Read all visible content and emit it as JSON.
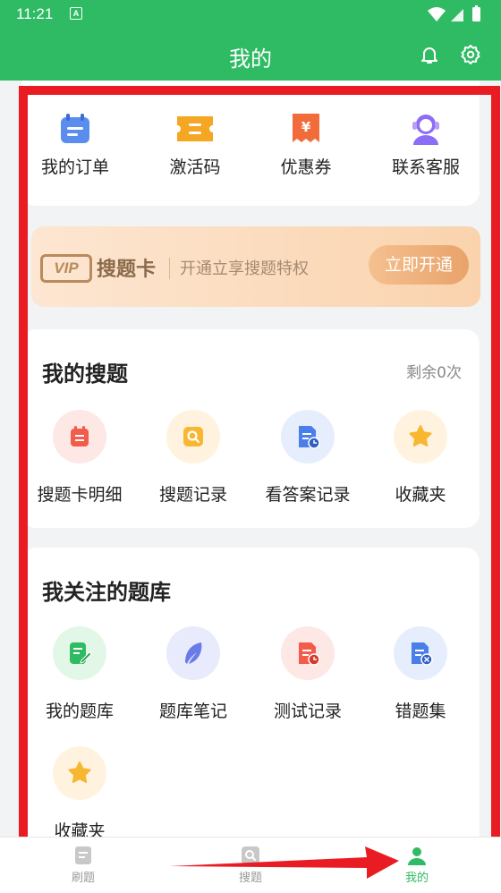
{
  "status_bar": {
    "time": "11:21",
    "notification_icon": "A"
  },
  "header": {
    "title": "我的"
  },
  "quick_actions": [
    {
      "label": "我的订单",
      "icon": "calendar-icon",
      "color": "#5b8def"
    },
    {
      "label": "激活码",
      "icon": "ticket-icon",
      "color": "#f5a623"
    },
    {
      "label": "优惠券",
      "icon": "coupon-icon",
      "color": "#f26b3a"
    },
    {
      "label": "联系客服",
      "icon": "headset-icon",
      "color": "#8d6df5"
    }
  ],
  "vip": {
    "badge": "VIP",
    "title": "搜题卡",
    "desc": "开通立享搜题特权",
    "button": "立即开通"
  },
  "my_search": {
    "title": "我的搜题",
    "remaining": "剩余0次",
    "items": [
      {
        "label": "搜题卡明细",
        "icon": "card-detail-icon"
      },
      {
        "label": "搜题记录",
        "icon": "search-record-icon"
      },
      {
        "label": "看答案记录",
        "icon": "answer-record-icon"
      },
      {
        "label": "收藏夹",
        "icon": "star-icon"
      }
    ]
  },
  "my_library": {
    "title": "我关注的题库",
    "items": [
      {
        "label": "我的题库",
        "icon": "edit-doc-icon"
      },
      {
        "label": "题库笔记",
        "icon": "feather-icon"
      },
      {
        "label": "测试记录",
        "icon": "test-record-icon"
      },
      {
        "label": "错题集",
        "icon": "wrong-doc-icon"
      },
      {
        "label": "收藏夹",
        "icon": "star-icon"
      }
    ]
  },
  "tabbar": [
    {
      "label": "刷题",
      "active": false
    },
    {
      "label": "搜题",
      "active": false
    },
    {
      "label": "我的",
      "active": true
    }
  ],
  "colors": {
    "brand": "#2fbb63",
    "annotation_red": "#e91c24"
  }
}
